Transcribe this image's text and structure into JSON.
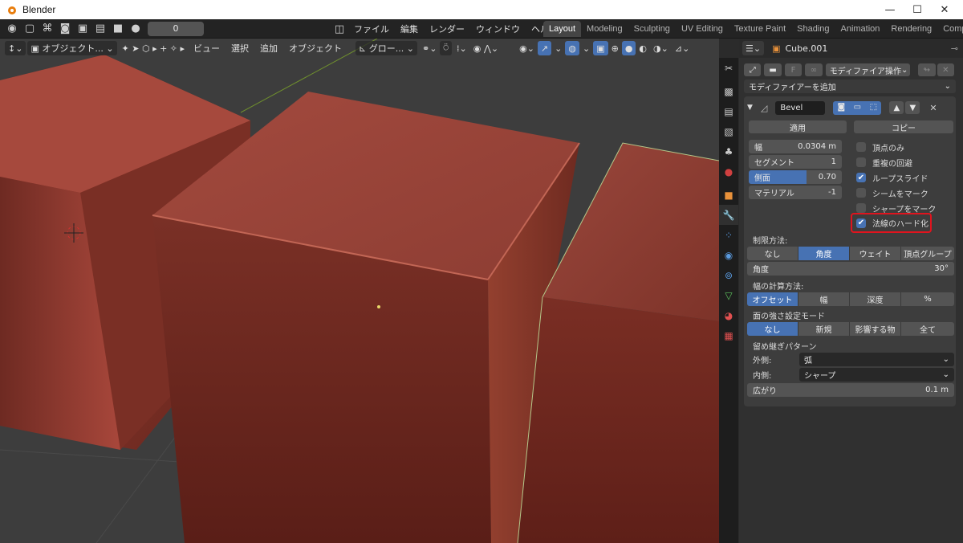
{
  "window": {
    "title": "Blender",
    "minimize": "—",
    "maximize": "☐",
    "close": "✕"
  },
  "topbar": {
    "frame_value": "0",
    "menus": [
      "ファイル",
      "編集",
      "レンダー",
      "ウィンドウ",
      "ヘルプ"
    ],
    "workspace_tabs": [
      "Layout",
      "Modeling",
      "Sculpting",
      "UV Editing",
      "Texture Paint",
      "Shading",
      "Animation",
      "Rendering",
      "Comp"
    ]
  },
  "viewport_header": {
    "mode": "オブジェクト...",
    "menus": [
      "ビュー",
      "選択",
      "追加",
      "オブジェクト"
    ],
    "orientation": "グロー..."
  },
  "properties": {
    "object_name": "Cube.001",
    "modifier_ops": "モディファイア操作",
    "add_modifier": "モディファイアーを追加",
    "modifier_name": "Bevel",
    "apply": "適用",
    "copy": "コピー",
    "fields": [
      {
        "label": "幅",
        "value": "0.0304 m"
      },
      {
        "label": "セグメント",
        "value": "1"
      },
      {
        "label": "側面",
        "value": "0.70"
      },
      {
        "label": "マテリアル",
        "value": "-1"
      }
    ],
    "checks": [
      {
        "label": "頂点のみ",
        "checked": false
      },
      {
        "label": "重複の回避",
        "checked": false
      },
      {
        "label": "ループスライド",
        "checked": true
      },
      {
        "label": "シームをマーク",
        "checked": false
      },
      {
        "label": "シャープをマーク",
        "checked": false
      },
      {
        "label": "法線のハード化",
        "checked": true
      }
    ],
    "limit_method_label": "制限方法:",
    "limit_methods": [
      "なし",
      "角度",
      "ウェイト",
      "頂点グループ"
    ],
    "angle": {
      "label": "角度",
      "value": "30°"
    },
    "width_type_label": "幅の計算方法:",
    "width_types": [
      "オフセット",
      "幅",
      "深度",
      "%"
    ],
    "face_strength_label": "面の強さ設定モード",
    "face_strengths": [
      "なし",
      "新規",
      "影響する物",
      "全て"
    ],
    "miter_label": "留め継ぎパターン",
    "outer": {
      "label": "外側:",
      "value": "弧"
    },
    "inner": {
      "label": "内側:",
      "value": "シャープ"
    },
    "spread": {
      "label": "広がり",
      "value": "0.1 m"
    }
  },
  "colors": {
    "accent": "#4772b3",
    "highlight": "#e0141e",
    "cube": "#9a3d33"
  }
}
